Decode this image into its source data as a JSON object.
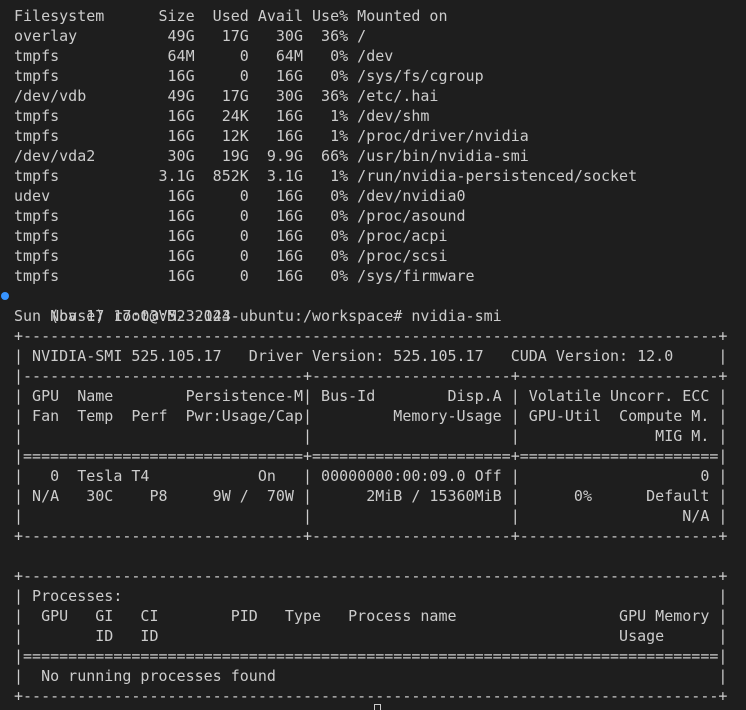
{
  "terminal": {
    "df_output": [
      "Filesystem      Size  Used Avail Use% Mounted on",
      "overlay          49G   17G   30G  36% /",
      "tmpfs            64M     0   64M   0% /dev",
      "tmpfs            16G     0   16G   0% /sys/fs/cgroup",
      "/dev/vdb         49G   17G   30G  36% /etc/.hai",
      "tmpfs            16G   24K   16G   1% /dev/shm",
      "tmpfs            16G   12K   16G   1% /proc/driver/nvidia",
      "/dev/vda2        30G   19G  9.9G  66% /usr/bin/nvidia-smi",
      "tmpfs           3.1G  852K  3.1G   1% /run/nvidia-persistenced/socket",
      "udev             16G     0   16G   0% /dev/nvidia0",
      "tmpfs            16G     0   16G   0% /proc/asound",
      "tmpfs            16G     0   16G   0% /proc/acpi",
      "tmpfs            16G     0   16G   0% /proc/scsi",
      "tmpfs            16G     0   16G   0% /sys/firmware"
    ],
    "prompt": "(base) root@VM-3-143-ubuntu:/workspace# nvidia-smi",
    "timestamp": "Sun Nov 17 17:03:52 2024",
    "gpu_table": [
      "+-----------------------------------------------------------------------------+",
      "| NVIDIA-SMI 525.105.17   Driver Version: 525.105.17   CUDA Version: 12.0     |",
      "|-------------------------------+----------------------+----------------------+",
      "| GPU  Name        Persistence-M| Bus-Id        Disp.A | Volatile Uncorr. ECC |",
      "| Fan  Temp  Perf  Pwr:Usage/Cap|         Memory-Usage | GPU-Util  Compute M. |",
      "|                               |                      |               MIG M. |",
      "|===============================+======================+======================|",
      "|   0  Tesla T4            On   | 00000000:00:09.0 Off |                    0 |",
      "| N/A   30C    P8     9W /  70W |      2MiB / 15360MiB |      0%      Default |",
      "|                               |                      |                  N/A |",
      "+-------------------------------+----------------------+----------------------+",
      "",
      "+-----------------------------------------------------------------------------+",
      "| Processes:                                                                  |",
      "|  GPU   GI   CI        PID   Type   Process name                  GPU Memory |",
      "|        ID   ID                                                   Usage      |",
      "|=============================================================================|",
      "|  No running processes found                                                 |",
      "+-----------------------------------------------------------------------------+"
    ]
  },
  "colors": {
    "background": "#1e1e1e",
    "text": "#cccccc",
    "prompt_marker": "#3794ff"
  }
}
